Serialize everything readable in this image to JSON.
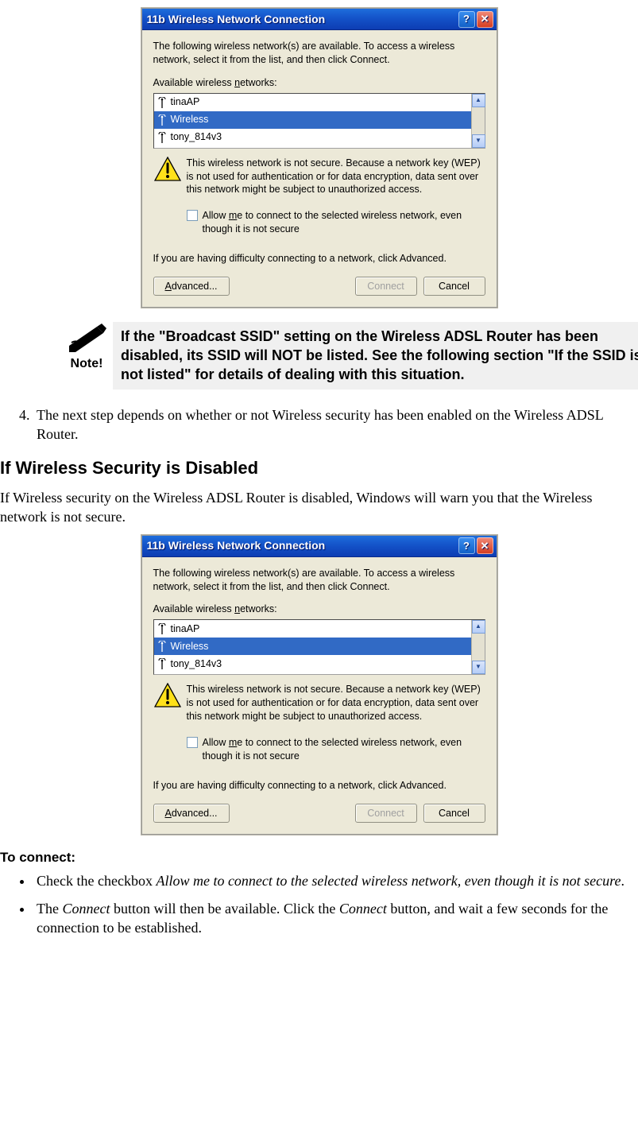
{
  "dialog": {
    "title": "11b Wireless Network Connection",
    "intro": "The following wireless network(s) are available. To access a wireless network, select it from the list, and then click Connect.",
    "available_label": "Available wireless networks:",
    "networks": [
      "tinaAP",
      "Wireless",
      "tony_814v3"
    ],
    "selected_index": 1,
    "warning": "This wireless network is not secure. Because a network key (WEP) is not used for authentication or for data encryption, data sent over this network might be subject to unauthorized access.",
    "allow_checkbox": "Allow me to connect to the selected wireless network, even though it is not secure",
    "difficulty": "If you are having difficulty connecting to a network, click Advanced.",
    "advanced_btn": "Advanced...",
    "connect_btn": "Connect",
    "cancel_btn": "Cancel"
  },
  "note": {
    "label": "Note!",
    "text": "If the \"Broadcast SSID\" setting on the Wireless ADSL Router has been disabled, its SSID will NOT be listed. See the following section \"If the SSID is not listed\" for details of dealing with this situation."
  },
  "step4": "The next step depends on whether or not Wireless security has been enabled on the Wireless ADSL Router.",
  "heading": "If Wireless Security is Disabled",
  "paragraph": "If Wireless security on the Wireless ADSL Router is disabled, Windows will warn you that the Wireless network is not secure.",
  "to_connect_heading": "To connect:",
  "bullets": {
    "b1_pre": "Check the checkbox ",
    "b1_em": "Allow me to connect to the selected wireless network, even though it is not secure",
    "b1_post": ".",
    "b2_a": "The ",
    "b2_em1": "Connect",
    "b2_b": " button will then be available. Click the ",
    "b2_em2": "Connect",
    "b2_c": " button, and wait a few seconds for the connection to be established."
  }
}
